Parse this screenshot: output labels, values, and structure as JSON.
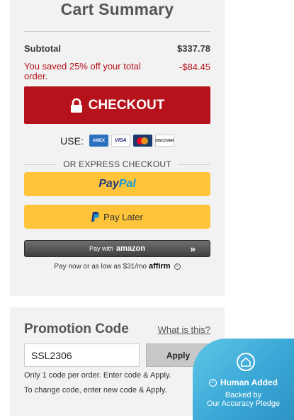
{
  "cart_summary": {
    "title": "Cart Summary",
    "subtotal_label": "Subtotal",
    "subtotal_value": "$337.78",
    "savings_label": "You saved 25% off your total order.",
    "savings_value": "-$84.45",
    "checkout_label": "CHECKOUT",
    "use_label": "USE:",
    "cards": [
      {
        "name": "amex",
        "text": "AMEX"
      },
      {
        "name": "visa",
        "text": "VISA"
      },
      {
        "name": "mastercard",
        "text": ""
      },
      {
        "name": "discover",
        "text": "DISCOVER"
      }
    ],
    "express_label": "OR EXPRESS CHECKOUT",
    "paypal": {
      "part1": "Pay",
      "part2": "Pal"
    },
    "paylater_label": "Pay Later",
    "amazon": {
      "prefix": "Pay with",
      "brand": "amazon",
      "arrows": "»"
    },
    "affirm": {
      "text": "Pay now or as low as $31/mo",
      "brand": "affirm",
      "info": "i"
    }
  },
  "promotion": {
    "title": "Promotion Code",
    "whats_this": "What is this?",
    "code_value": "SSL2306",
    "apply_label": "Apply",
    "note1": "Only 1 code per order. Enter code & Apply.",
    "note2": "To change code, enter new code & Apply."
  },
  "badge": {
    "title": "Human Added",
    "line1": "Backed by",
    "line2": "Our Accuracy Pledge"
  },
  "colors": {
    "checkout": "#b5121b",
    "paypal_yellow": "#ffc439",
    "badge_blue": "#3aa8d6"
  }
}
